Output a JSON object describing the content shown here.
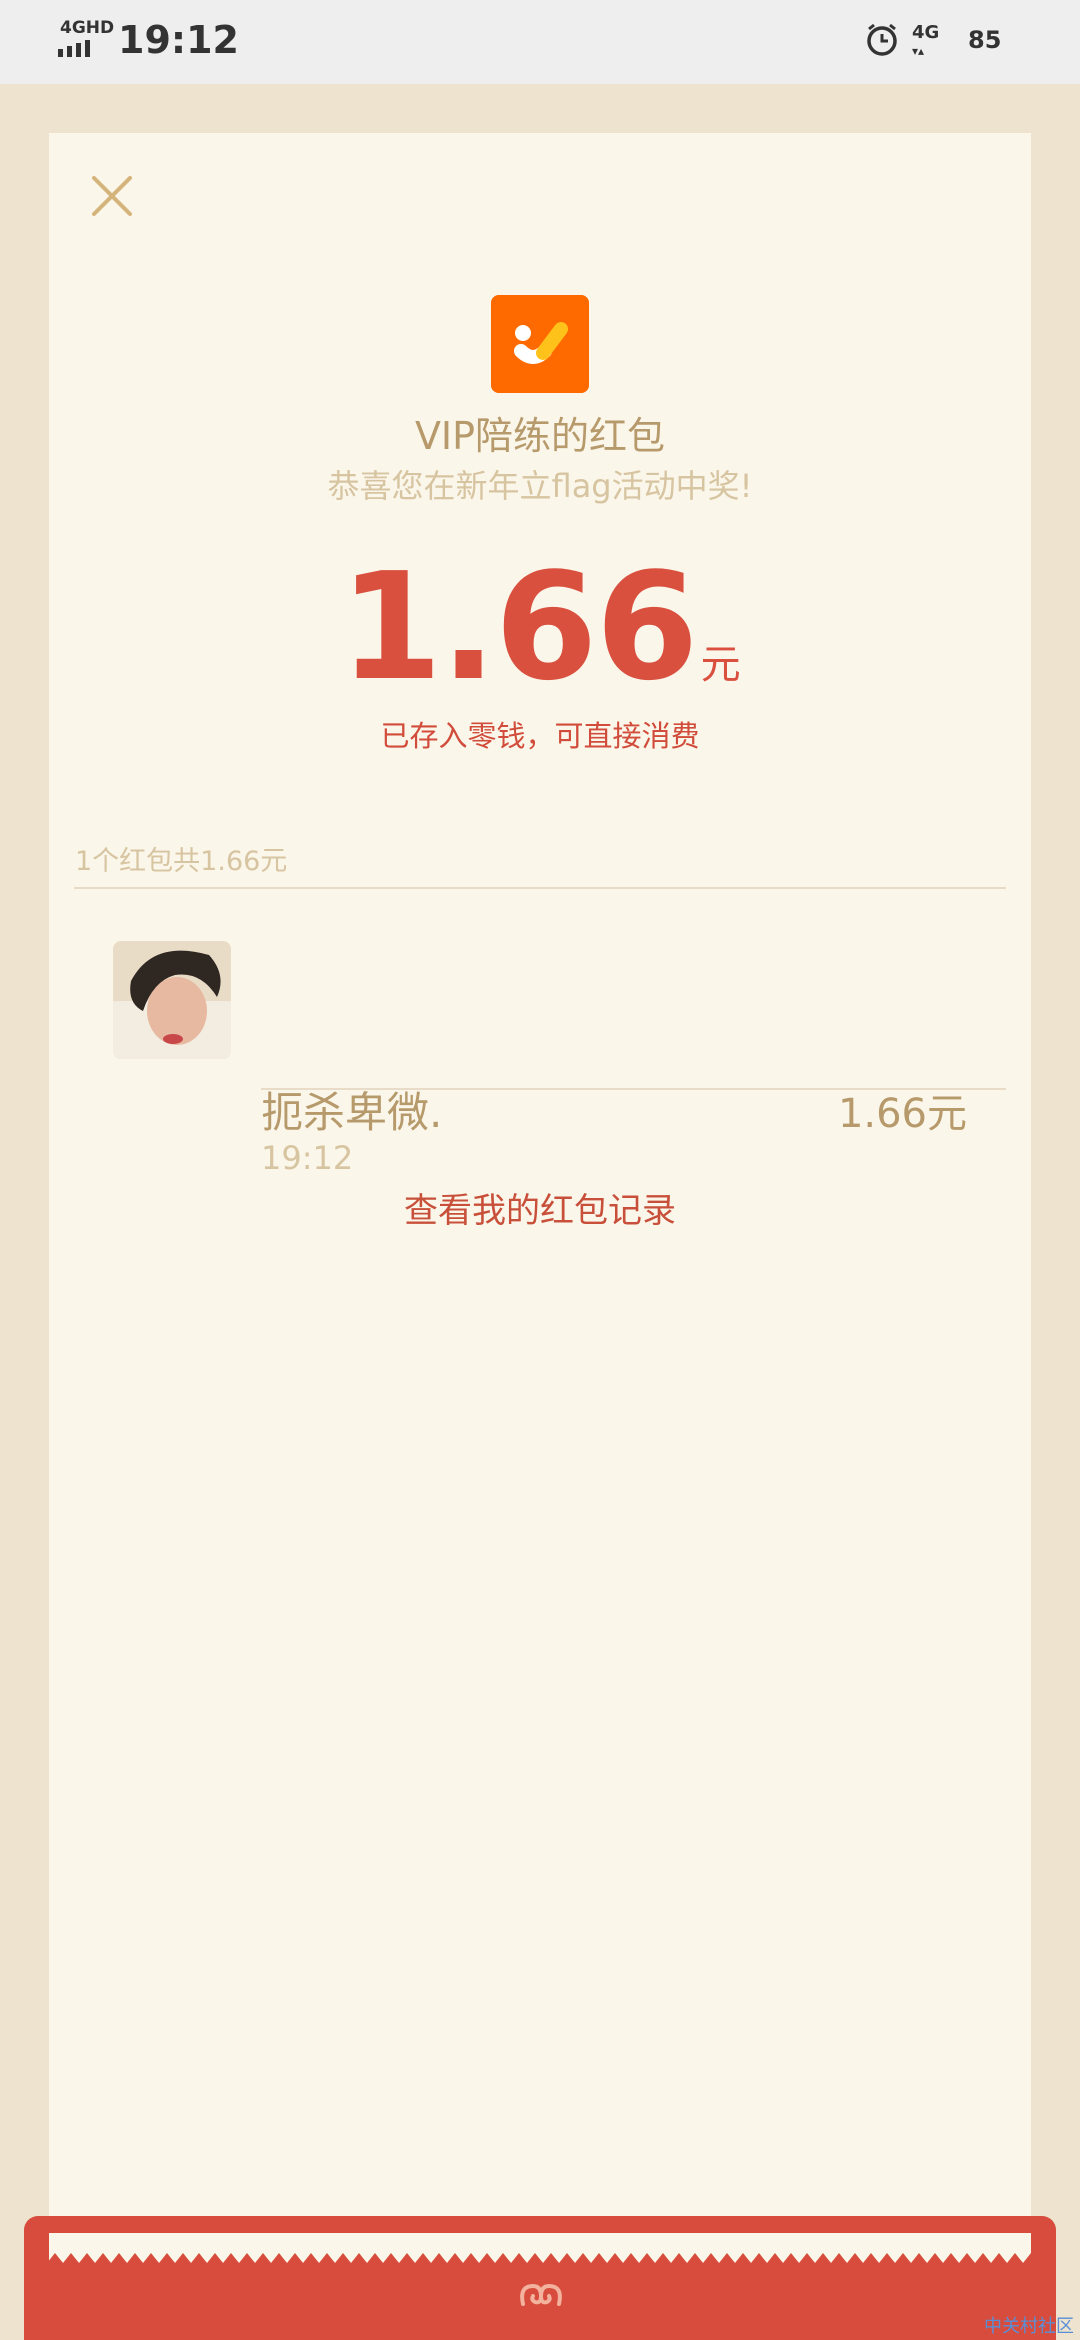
{
  "status_bar": {
    "network": "4GHD",
    "time": "19:12",
    "mobile_data": "4G",
    "battery_level": "85"
  },
  "packet": {
    "app_name": "VIP陪练的红包",
    "congrats": "恭喜您在新年立flag活动中奖!",
    "amount": "1.66",
    "unit": "元",
    "stored_note": "已存入零钱，可直接消费",
    "summary": "1个红包共1.66元",
    "history_link": "查看我的红包记录"
  },
  "recipients": [
    {
      "name": "扼杀卑微.",
      "time": "19:12",
      "amount": "1.66元"
    }
  ],
  "watermark": "中关村社区",
  "colors": {
    "accent_red": "#d9503f",
    "gold_text": "#b79a6b",
    "card_bg": "#fbf6ea",
    "page_bg": "#ede3cf",
    "logo_orange": "#ff6a00"
  }
}
